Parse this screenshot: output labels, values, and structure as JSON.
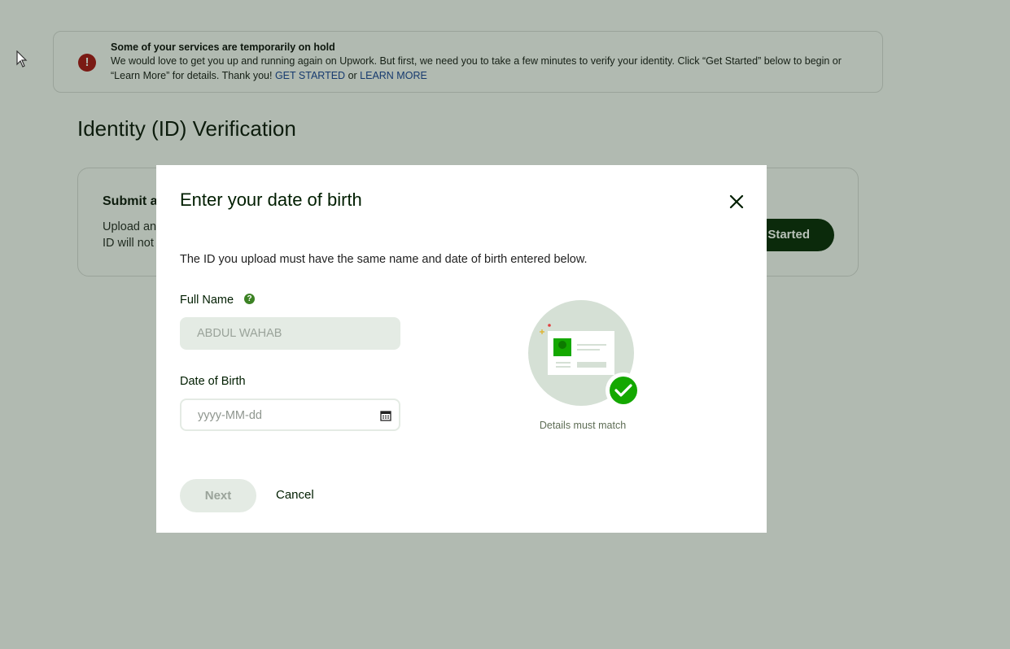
{
  "alert": {
    "title": "Some of your services are temporarily on hold",
    "body_line1": "We would love to get you up and running again on Upwork. But first, we need you to take a few minutes to verify your identity. Click “Get Started” below to begin or",
    "body_line2_prefix": "“Learn More” for details. Thank you! ",
    "get_started_link": "GET STARTED",
    "or_text": " or ",
    "learn_more_link": "LEARN MORE",
    "icon": "exclamation-icon"
  },
  "page": {
    "title": "Identity (ID) Verification"
  },
  "card": {
    "title": "Submit a",
    "text_line1": "Upload an",
    "text_line2": "ID will not",
    "button_label": "Started"
  },
  "modal": {
    "title": "Enter your date of birth",
    "intro": "The ID you upload must have the same name and date of birth entered below.",
    "full_name_label": "Full Name",
    "full_name_value": "ABDUL WAHAB",
    "dob_label": "Date of Birth",
    "dob_placeholder": "yyyy-MM-dd",
    "illustration_caption": "Details must match",
    "next_label": "Next",
    "cancel_label": "Cancel"
  },
  "colors": {
    "overlay": "#b1bab1",
    "brand_green": "#14a800",
    "alert_red": "#7a1a14",
    "link_blue": "#163a6e"
  }
}
